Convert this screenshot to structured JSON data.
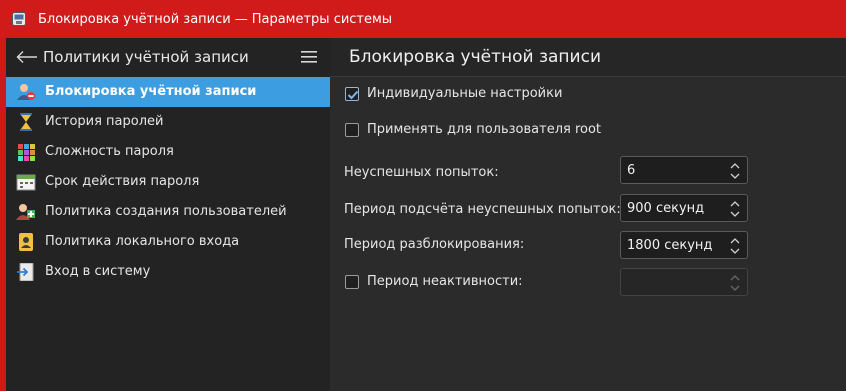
{
  "window": {
    "title_left": "Блокировка учётной записи",
    "title_sep": "—",
    "title_right": "Параметры системы"
  },
  "sidebar": {
    "title": "Политики учётной записи",
    "items": [
      {
        "label": "Блокировка учётной записи",
        "icon": "user-lock-icon",
        "active": true
      },
      {
        "label": "История паролей",
        "icon": "hourglass-icon",
        "active": false
      },
      {
        "label": "Сложность пароля",
        "icon": "grid-icon",
        "active": false
      },
      {
        "label": "Срок действия пароля",
        "icon": "calendar-icon",
        "active": false
      },
      {
        "label": "Политика создания пользователей",
        "icon": "user-add-icon",
        "active": false
      },
      {
        "label": "Политика локального входа",
        "icon": "user-badge-icon",
        "active": false
      },
      {
        "label": "Вход в систему",
        "icon": "login-icon",
        "active": false
      }
    ]
  },
  "main": {
    "title": "Блокировка учётной записи",
    "individual": {
      "label": "Индивидуальные настройки",
      "checked": true
    },
    "apply_root": {
      "label": "Применять для пользователя root",
      "checked": false
    },
    "fields": [
      {
        "label": "Неуспешных попыток:",
        "value": "6"
      },
      {
        "label": "Период подсчёта неуспешных попыток:",
        "value": "900 секунд"
      },
      {
        "label": "Период разблокирования:",
        "value": "1800 секунд"
      }
    ],
    "inactivity": {
      "label": "Период неактивности:",
      "checked": false,
      "value": ""
    }
  },
  "colors": {
    "titlebar": "#d11b1b",
    "accent": "#3c9de0",
    "background": "#2a2a2a"
  }
}
